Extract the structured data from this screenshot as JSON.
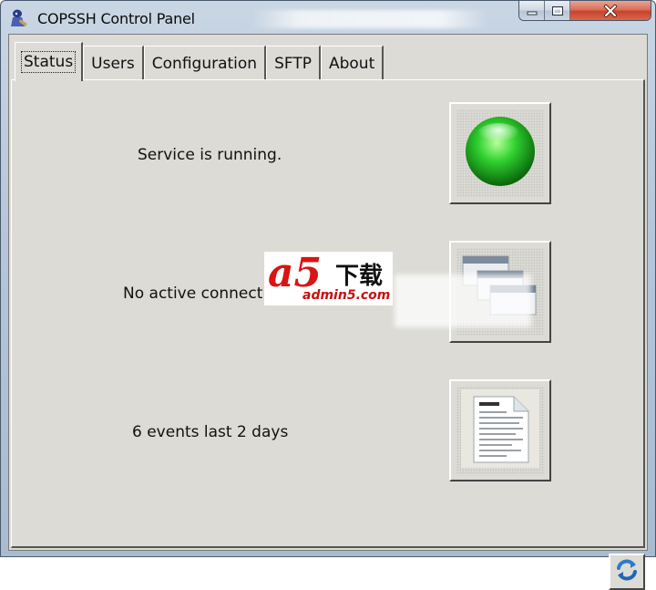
{
  "window": {
    "title": "COPSSH Control Panel",
    "icon": "copssh-app-icon"
  },
  "caption_buttons": [
    "minimize-icon",
    "maximize-icon",
    "close-icon"
  ],
  "tabs": [
    {
      "label": "Status",
      "active": true
    },
    {
      "label": "Users",
      "active": false
    },
    {
      "label": "Configuration",
      "active": false
    },
    {
      "label": "SFTP",
      "active": false
    },
    {
      "label": "About",
      "active": false
    }
  ],
  "status": {
    "service": {
      "text": "Service is running.",
      "icon": "green-status-light-icon"
    },
    "connections": {
      "text": "No active connectio",
      "icon": "connections-windows-icon"
    },
    "events": {
      "text": "6 events last 2 days",
      "icon": "document-icon"
    }
  },
  "refresh": {
    "icon": "refresh-icon"
  },
  "watermark": {
    "brand": "a5",
    "chinese": "下载",
    "url": "admin5.com"
  },
  "colors": {
    "panel_bg": "#dcdbd5",
    "status_green": "#2fd12f",
    "refresh_blue": "#2a7bd1",
    "close_red": "#c7432b"
  }
}
